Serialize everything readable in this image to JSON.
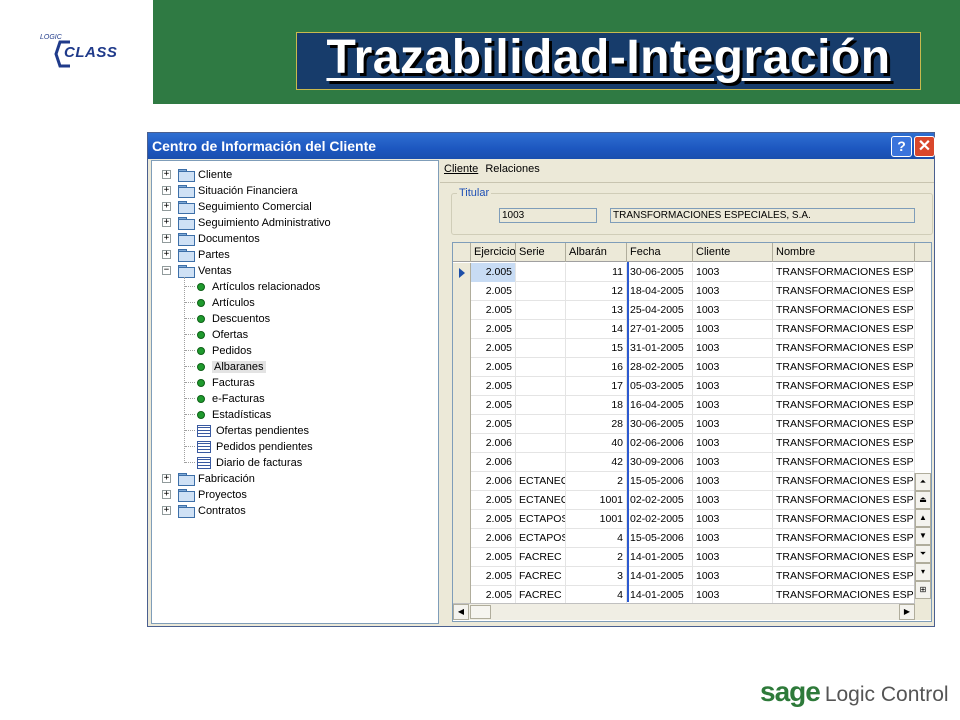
{
  "slide": {
    "title": "Trazabilidad-Integración",
    "logo_small": "LOGIC",
    "logo_main": "CLASS",
    "footer_brand": "sage",
    "footer_product": "Logic Control"
  },
  "window": {
    "title": "Centro de Información del Cliente",
    "help_label": "?",
    "close_label": "✕"
  },
  "tree": {
    "items": [
      {
        "label": "Cliente",
        "icon": "folder-icon",
        "expander": "+"
      },
      {
        "label": "Situación Financiera",
        "icon": "folder-icon",
        "expander": "+"
      },
      {
        "label": "Seguimiento Comercial",
        "icon": "folder-icon",
        "expander": "+"
      },
      {
        "label": "Seguimiento Administrativo",
        "icon": "folder-icon",
        "expander": "+"
      },
      {
        "label": "Documentos",
        "icon": "folder-icon",
        "expander": "+"
      },
      {
        "label": "Partes",
        "icon": "folder-icon",
        "expander": "+"
      },
      {
        "label": "Ventas",
        "icon": "folder-open-icon",
        "expander": "−"
      },
      {
        "label": "Artículos relacionados",
        "icon": "green-dot-icon"
      },
      {
        "label": "Artículos",
        "icon": "green-dot-icon"
      },
      {
        "label": "Descuentos",
        "icon": "green-dot-icon"
      },
      {
        "label": "Ofertas",
        "icon": "green-dot-icon"
      },
      {
        "label": "Pedidos",
        "icon": "green-dot-icon"
      },
      {
        "label": "Albaranes",
        "icon": "green-dot-icon",
        "selected": true
      },
      {
        "label": "Facturas",
        "icon": "green-dot-icon"
      },
      {
        "label": "e-Facturas",
        "icon": "green-dot-icon"
      },
      {
        "label": "Estadísticas",
        "icon": "green-dot-icon"
      },
      {
        "label": "Ofertas pendientes",
        "icon": "grid-icon"
      },
      {
        "label": "Pedidos pendientes",
        "icon": "grid-icon"
      },
      {
        "label": "Diario de facturas",
        "icon": "grid-icon"
      },
      {
        "label": "Fabricación",
        "icon": "folder-icon",
        "expander": "+"
      },
      {
        "label": "Proyectos",
        "icon": "folder-icon",
        "expander": "+"
      },
      {
        "label": "Contratos",
        "icon": "folder-icon",
        "expander": "+"
      }
    ]
  },
  "menu": {
    "cliente": "Cliente",
    "relaciones": "Relaciones"
  },
  "titular": {
    "legend": "Titular",
    "code": "1003",
    "name": "TRANSFORMACIONES ESPECIALES, S.A."
  },
  "grid": {
    "columns": [
      "Ejercicio",
      "Serie",
      "Albarán",
      "Fecha",
      "Cliente",
      "Nombre"
    ],
    "rows": [
      [
        "2.005",
        "",
        "11",
        "30-06-2005",
        "1003",
        "TRANSFORMACIONES ESPEC"
      ],
      [
        "2.005",
        "",
        "12",
        "18-04-2005",
        "1003",
        "TRANSFORMACIONES ESPEC"
      ],
      [
        "2.005",
        "",
        "13",
        "25-04-2005",
        "1003",
        "TRANSFORMACIONES ESPEC"
      ],
      [
        "2.005",
        "",
        "14",
        "27-01-2005",
        "1003",
        "TRANSFORMACIONES ESPEC"
      ],
      [
        "2.005",
        "",
        "15",
        "31-01-2005",
        "1003",
        "TRANSFORMACIONES ESPEC"
      ],
      [
        "2.005",
        "",
        "16",
        "28-02-2005",
        "1003",
        "TRANSFORMACIONES ESPEC"
      ],
      [
        "2.005",
        "",
        "17",
        "05-03-2005",
        "1003",
        "TRANSFORMACIONES ESPEC"
      ],
      [
        "2.005",
        "",
        "18",
        "16-04-2005",
        "1003",
        "TRANSFORMACIONES ESPEC"
      ],
      [
        "2.005",
        "",
        "28",
        "30-06-2005",
        "1003",
        "TRANSFORMACIONES ESPEC"
      ],
      [
        "2.006",
        "",
        "40",
        "02-06-2006",
        "1003",
        "TRANSFORMACIONES ESPEC"
      ],
      [
        "2.006",
        "",
        "42",
        "30-09-2006",
        "1003",
        "TRANSFORMACIONES ESPEC"
      ],
      [
        "2.006",
        "ECTANEG",
        "2",
        "15-05-2006",
        "1003",
        "TRANSFORMACIONES ESPEC"
      ],
      [
        "2.005",
        "ECTANEG",
        "1001",
        "02-02-2005",
        "1003",
        "TRANSFORMACIONES ESPEC"
      ],
      [
        "2.005",
        "ECTAPOS",
        "1001",
        "02-02-2005",
        "1003",
        "TRANSFORMACIONES ESPEC"
      ],
      [
        "2.006",
        "ECTAPOS",
        "4",
        "15-05-2006",
        "1003",
        "TRANSFORMACIONES ESPEC"
      ],
      [
        "2.005",
        "FACREC",
        "2",
        "14-01-2005",
        "1003",
        "TRANSFORMACIONES ESPEC"
      ],
      [
        "2.005",
        "FACREC",
        "3",
        "14-01-2005",
        "1003",
        "TRANSFORMACIONES ESPEC"
      ],
      [
        "2.005",
        "FACREC",
        "4",
        "14-01-2005",
        "1003",
        "TRANSFORMACIONES ESPEC"
      ]
    ],
    "selected_row": 0
  },
  "colors": {
    "banner_green": "#2f7a43",
    "title_navy": "#173c6b",
    "window_blue": "#1d57c0",
    "selected_cell": "#c8dcf4"
  }
}
